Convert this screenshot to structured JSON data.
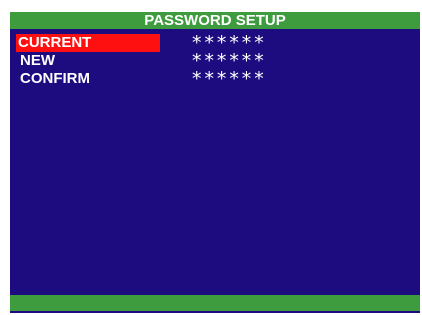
{
  "title": "PASSWORD SETUP",
  "fields": [
    {
      "label": "CURRENT",
      "value": "******"
    },
    {
      "label": "NEW",
      "value": "******"
    },
    {
      "label": "CONFIRM",
      "value": "******"
    }
  ],
  "colors": {
    "background": "#1d0c80",
    "title_bar": "#3e9b3e",
    "selected": "#ff1010",
    "text": "#ffffff"
  }
}
